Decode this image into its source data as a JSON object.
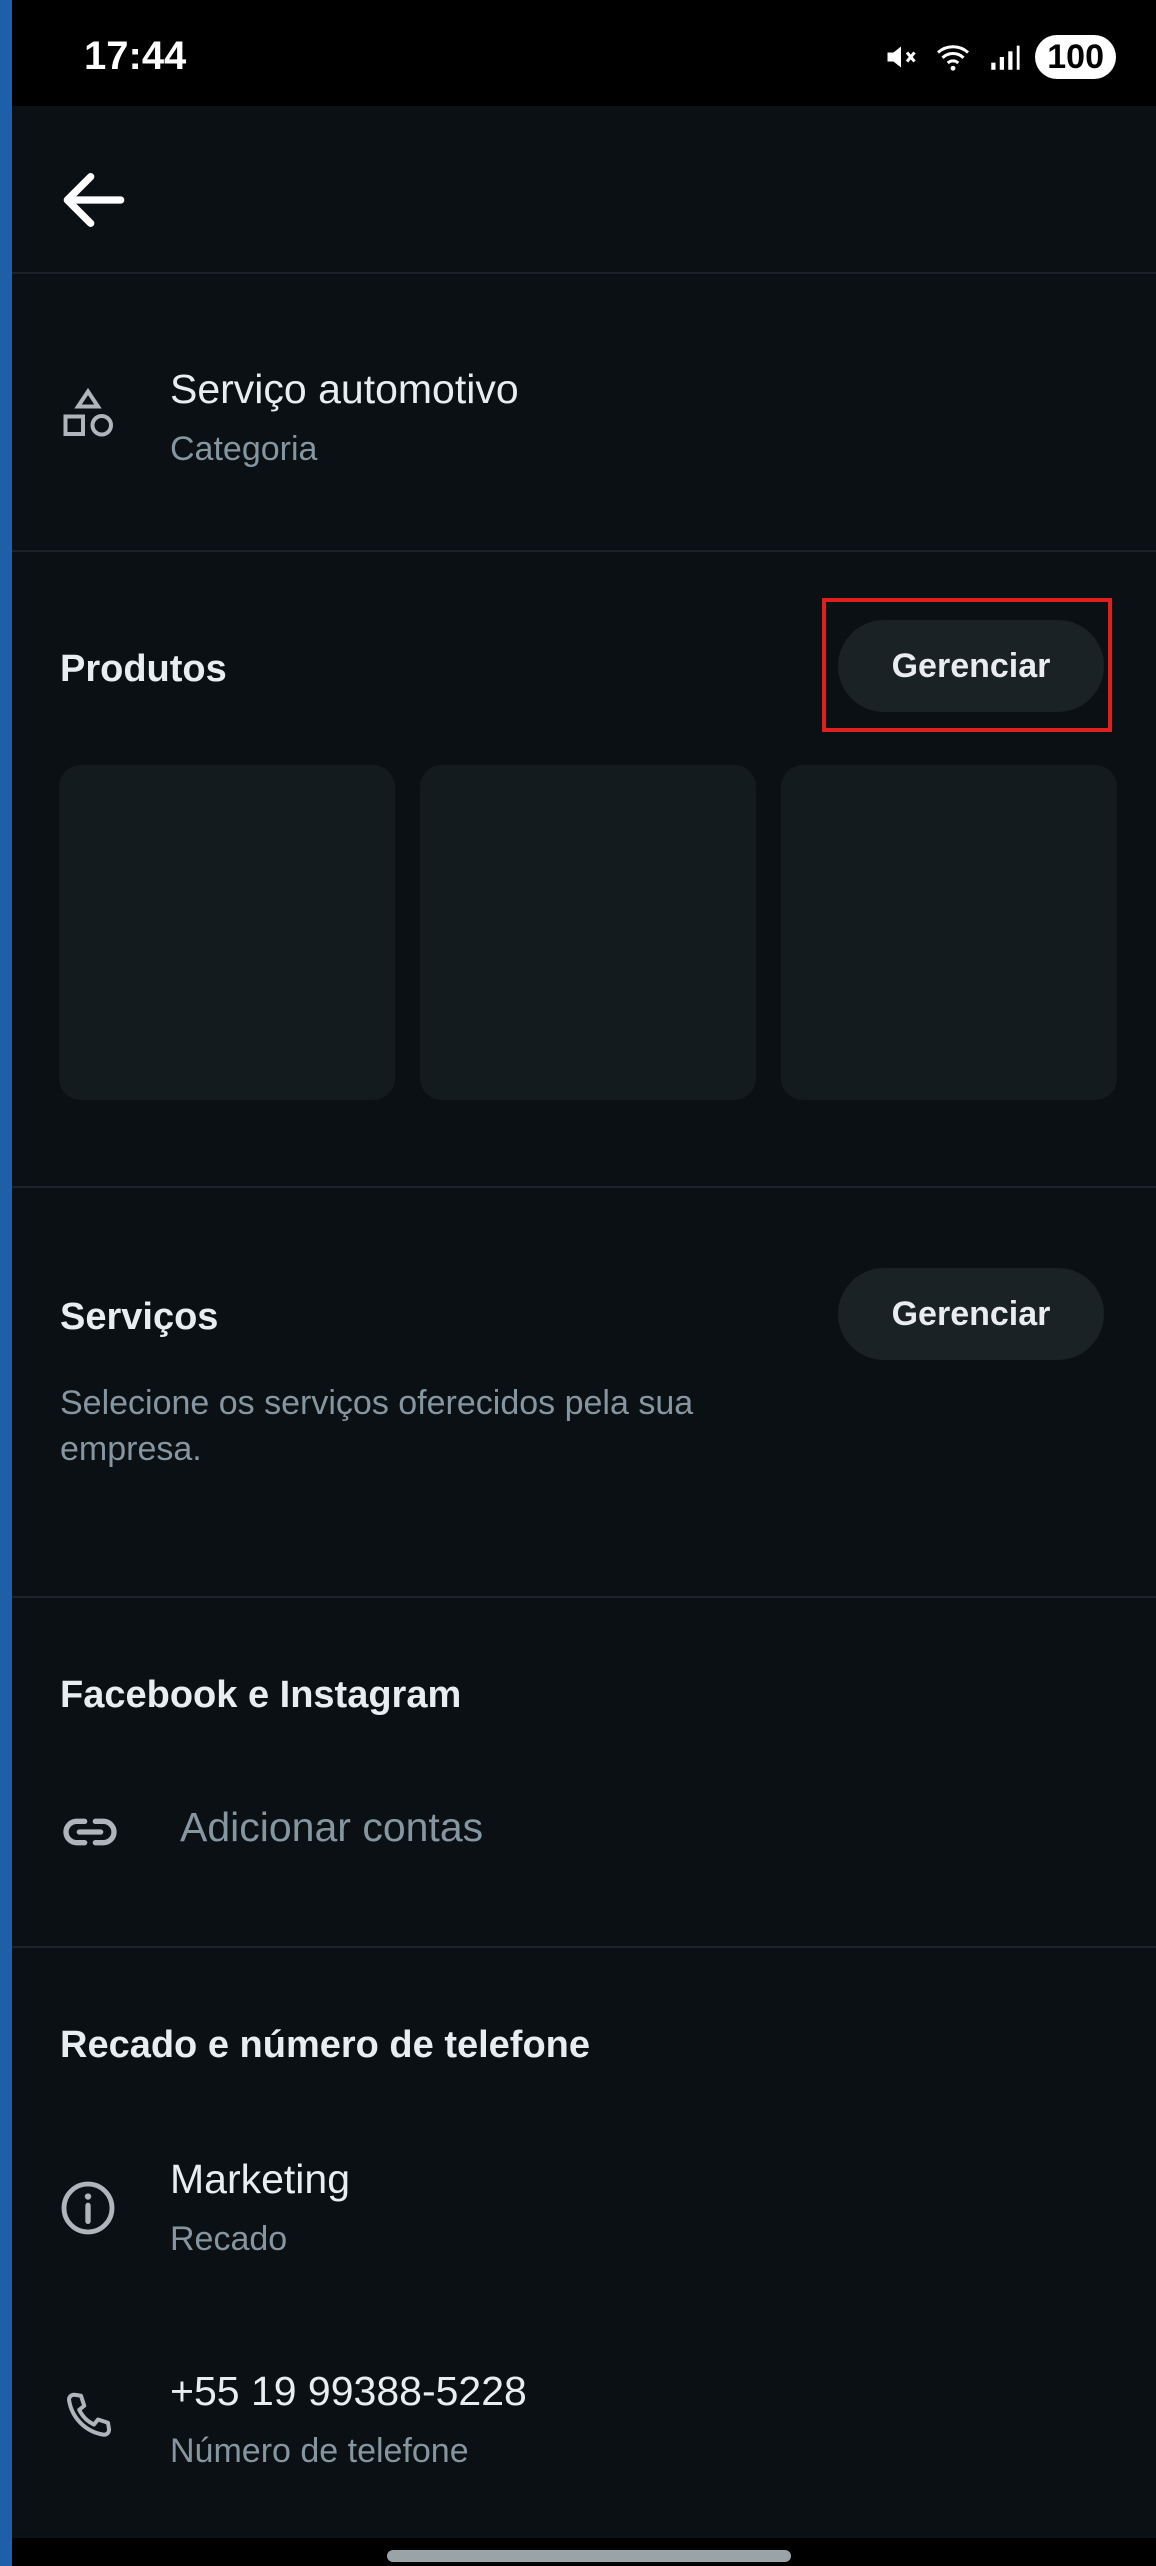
{
  "status_bar": {
    "time": "17:44",
    "battery": "100",
    "icons": [
      "mute-icon",
      "wifi-icon",
      "signal-icon",
      "battery-icon"
    ]
  },
  "category": {
    "title": "Serviço automotivo",
    "subtitle": "Categoria",
    "icon": "shapes-icon"
  },
  "produtos": {
    "title": "Produtos",
    "button": "Gerenciar"
  },
  "servicos": {
    "title": "Serviços",
    "button": "Gerenciar",
    "description": "Selecione os serviços oferecidos pela sua empresa."
  },
  "social": {
    "title": "Facebook e Instagram",
    "add_accounts": "Adicionar contas",
    "icon": "link-icon"
  },
  "recado": {
    "title": "Recado e número de telefone",
    "message_value": "Marketing",
    "message_label": "Recado",
    "phone_value": "+55 19 99388-5228",
    "phone_label": "Número de telefone"
  },
  "colors": {
    "background": "#0b1014",
    "text_primary": "#e9edef",
    "text_secondary": "#8696a0",
    "highlight": "#e0201e",
    "pill": "#1a2226"
  }
}
